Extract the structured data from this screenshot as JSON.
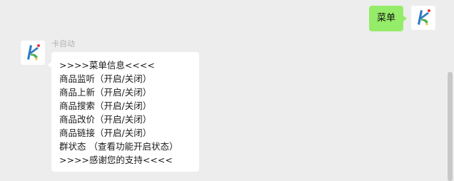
{
  "chat": {
    "my_message": "菜单",
    "bot_name": "卡自动",
    "bot_message_lines": [
      ">>>>菜单信息<<<<",
      "商品监听（开启/关闭）",
      "商品上新（开启/关闭）",
      "商品搜索（开启/关闭）",
      "商品改价（开启/关闭）",
      "商品链接（开启/关闭）",
      "群状态 （查看功能开启状态）",
      ">>>>感谢您的支持<<<<"
    ]
  },
  "icons": {
    "my_avatar": "avatar-logo-icon",
    "bot_avatar": "avatar-logo-icon"
  },
  "colors": {
    "background": "#ededed",
    "my_bubble": "#95ec69",
    "bot_bubble": "#ffffff",
    "sender_name": "#b2b2b2",
    "scrollbar": "#c8c8c8"
  }
}
